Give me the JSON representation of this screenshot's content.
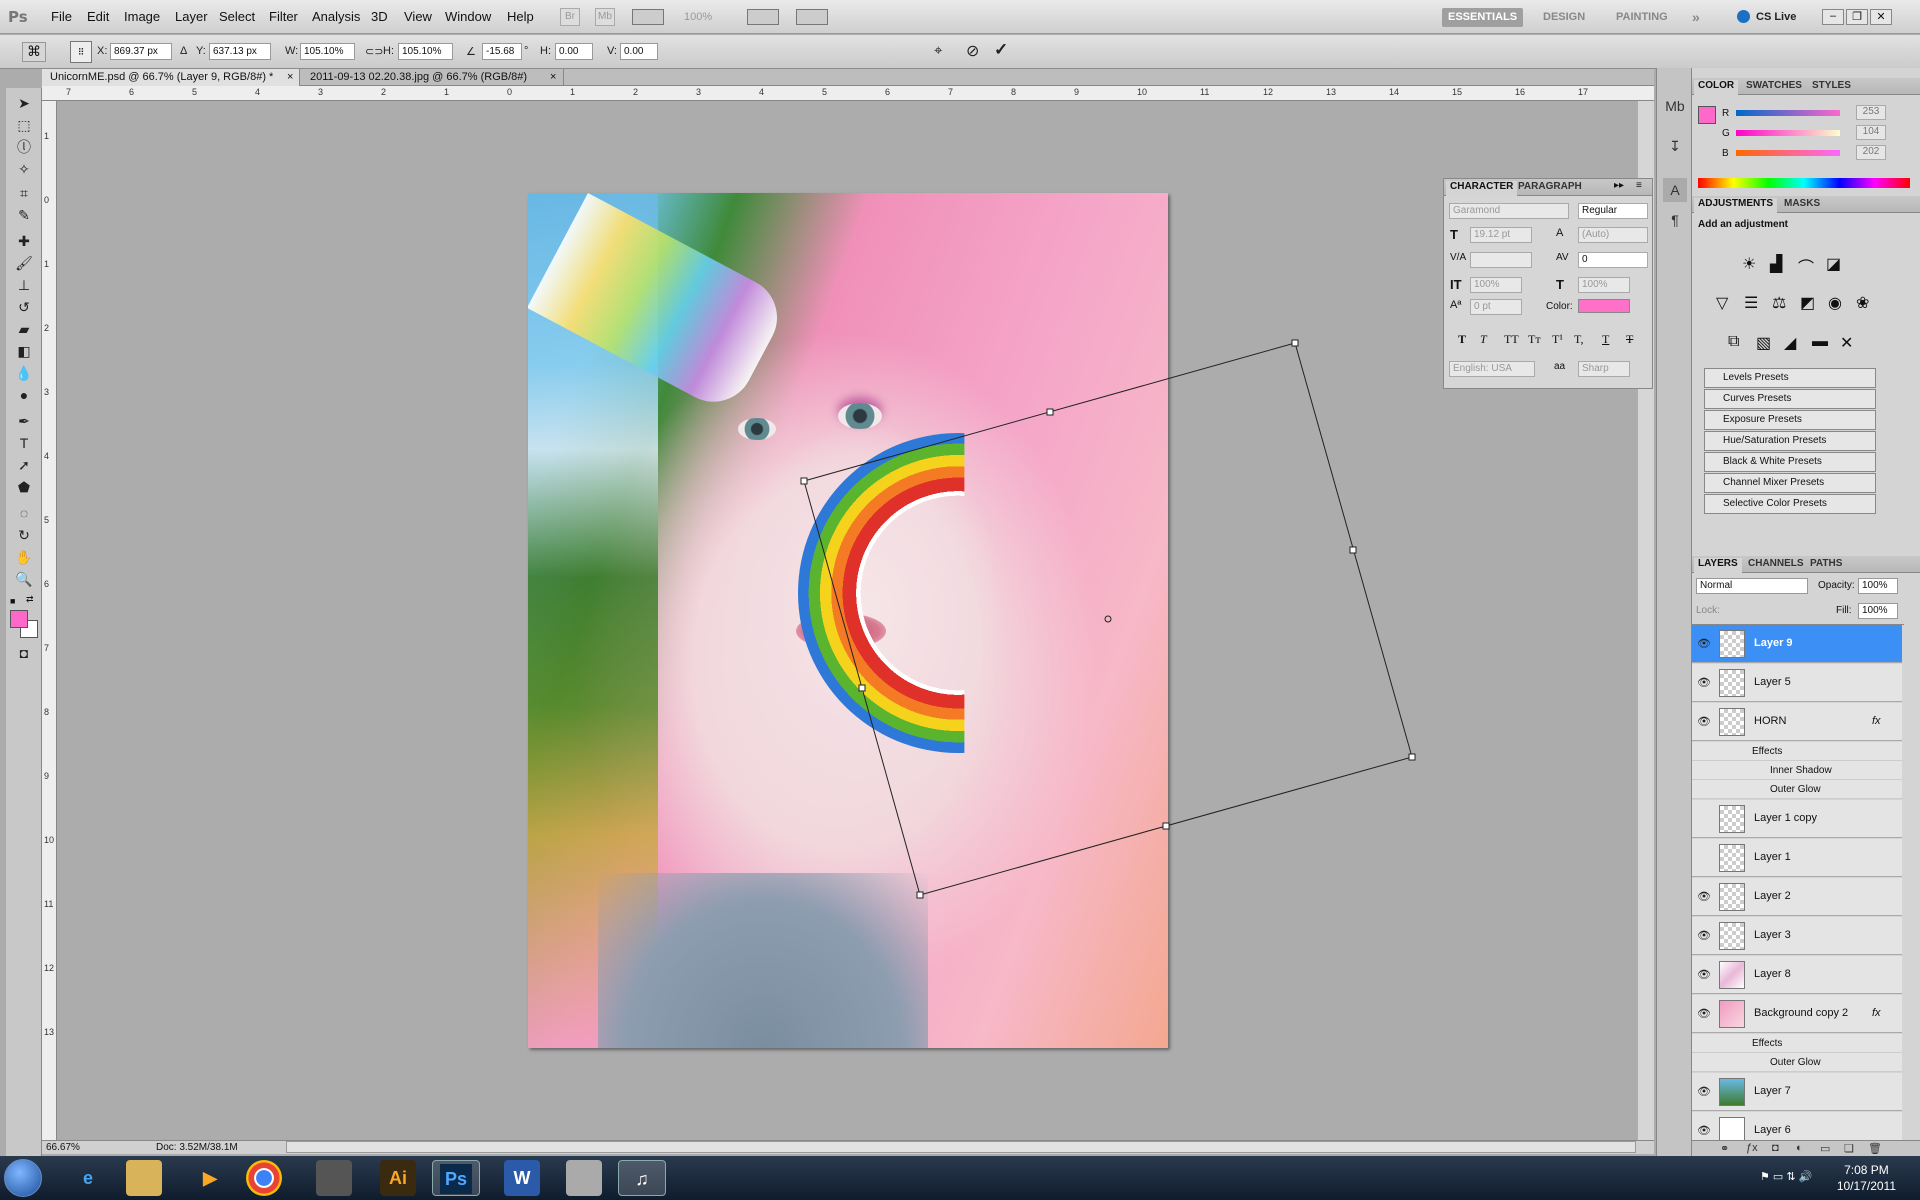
{
  "app": {
    "logo": "Ps"
  },
  "menu": [
    "File",
    "Edit",
    "Image",
    "Layer",
    "Select",
    "Filter",
    "Analysis",
    "3D",
    "View",
    "Window",
    "Help"
  ],
  "menubar_misc": {
    "br": "Br",
    "mb": "Mb",
    "zoom": "100%"
  },
  "workspaces": {
    "essentials": "ESSENTIALS",
    "design": "DESIGN",
    "painting": "PAINTING",
    "more": "»",
    "cslive": "CS Live"
  },
  "options": {
    "x_label": "X:",
    "x": "869.37 px",
    "y_label": "Y:",
    "y": "637.13 px",
    "w_label": "W:",
    "w": "105.10%",
    "h_label": "H:",
    "h": "105.10%",
    "angle": "-15.68",
    "deg": "°",
    "hskew_label": "H:",
    "hskew": "0.00",
    "vskew_label": "V:",
    "vskew": "0.00"
  },
  "tabs": [
    {
      "label": "UnicornME.psd @ 66.7% (Layer 9, RGB/8#) *",
      "close": "×"
    },
    {
      "label": "2011-09-13 02.20.38.jpg @ 66.7% (RGB/8#)",
      "close": "×"
    }
  ],
  "ruler_top": [
    "7",
    "6",
    "5",
    "4",
    "3",
    "2",
    "1",
    "0",
    "1",
    "2",
    "3",
    "4",
    "5",
    "6",
    "7",
    "8",
    "9",
    "10",
    "11",
    "12",
    "13",
    "14",
    "15",
    "16",
    "17"
  ],
  "ruler_left": [
    "1",
    "0",
    "1",
    "2",
    "3",
    "4",
    "5",
    "6",
    "7",
    "8",
    "9",
    "10",
    "11",
    "12",
    "13"
  ],
  "status": {
    "zoom": "66.67%",
    "doc": "Doc: 3.52M/38.1M"
  },
  "color_panel": {
    "tabs": [
      "COLOR",
      "SWATCHES",
      "STYLES"
    ],
    "r_label": "R",
    "r": "253",
    "g_label": "G",
    "g": "104",
    "b_label": "B",
    "b": "202",
    "fg_color": "#fd68ca"
  },
  "adjustments_panel": {
    "tabs": [
      "ADJUSTMENTS",
      "MASKS"
    ],
    "heading": "Add an adjustment",
    "presets": [
      "Levels Presets",
      "Curves Presets",
      "Exposure Presets",
      "Hue/Saturation Presets",
      "Black & White Presets",
      "Channel Mixer Presets",
      "Selective Color Presets"
    ]
  },
  "character_panel": {
    "tabs": [
      "CHARACTER",
      "PARAGRAPH"
    ],
    "font": "Garamond",
    "style": "Regular",
    "size": "19.12 pt",
    "leading": "(Auto)",
    "tracking": "0",
    "vscale": "100%",
    "hscale": "100%",
    "baseline": "0 pt",
    "color_label": "Color:",
    "color": "#ff70c8",
    "type_buttons": [
      "T",
      "T",
      "TT",
      "Tт",
      "T¹",
      "T,",
      "T",
      "T"
    ],
    "language": "English: USA",
    "aa_label": "aa",
    "antialias": "Sharp"
  },
  "layers_panel": {
    "tabs": [
      "LAYERS",
      "CHANNELS",
      "PATHS"
    ],
    "blend": "Normal",
    "opacity_label": "Opacity:",
    "opacity": "100%",
    "lock_label": "Lock:",
    "fill_label": "Fill:",
    "fill": "100%",
    "layers": [
      {
        "name": "Layer 9",
        "selected": true,
        "visible": true
      },
      {
        "name": "Layer 5",
        "selected": false,
        "visible": true
      },
      {
        "name": "HORN",
        "selected": false,
        "visible": true,
        "fx": "fx",
        "effects": [
          "Effects",
          "Inner Shadow",
          "Outer Glow"
        ]
      },
      {
        "name": "Layer 1 copy",
        "selected": false,
        "visible": false
      },
      {
        "name": "Layer 1",
        "selected": false,
        "visible": false
      },
      {
        "name": "Layer 2",
        "selected": false,
        "visible": true
      },
      {
        "name": "Layer 3",
        "selected": false,
        "visible": true
      },
      {
        "name": "Layer 8",
        "selected": false,
        "visible": true
      },
      {
        "name": "Background copy 2",
        "selected": false,
        "visible": true,
        "fx": "fx",
        "effects": [
          "Effects",
          "Outer Glow"
        ]
      },
      {
        "name": "Layer 7",
        "selected": false,
        "visible": true
      },
      {
        "name": "Layer 6",
        "selected": false,
        "visible": true
      }
    ]
  },
  "taskbar": {
    "apps": [
      "ie-icon",
      "explorer-icon",
      "media-player-icon",
      "chrome-icon",
      "utility-icon",
      "illustrator-icon",
      "photoshop-icon",
      "word-icon",
      "calculator-icon",
      "itunes-icon"
    ],
    "ai_label": "Ai",
    "ps_label": "Ps",
    "word_label": "W",
    "time": "7:08 PM",
    "date": "10/17/2011"
  }
}
